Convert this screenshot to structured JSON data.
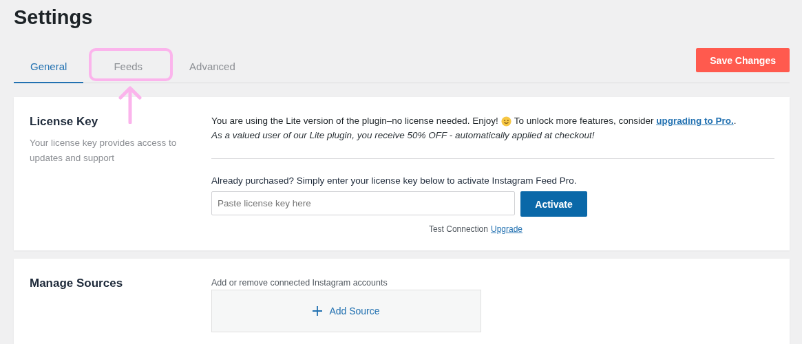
{
  "page": {
    "title": "Settings"
  },
  "tabs": [
    {
      "label": "General",
      "selected": true
    },
    {
      "label": "Feeds",
      "selected": false
    },
    {
      "label": "Advanced",
      "selected": false
    }
  ],
  "save_button": "Save Changes",
  "license": {
    "title": "License Key",
    "description": "Your license key provides access to updates and support",
    "intro_before": "You are using the Lite version of the plugin–no license needed. Enjoy!",
    "intro_after": "To unlock more features, consider",
    "intro_link": "upgrading to Pro.",
    "intro_end": ".",
    "discount": "As a valued user of our Lite plugin, you receive 50% OFF - automatically applied at checkout!",
    "prompt": "Already purchased? Simply enter your license key below to activate Instagram Feed Pro.",
    "field": {
      "placeholder": "Paste license key here"
    },
    "activate_button": "Activate",
    "test_connection": "Test Connection",
    "upgrade_link": "Upgrade"
  },
  "sources": {
    "title": "Manage Sources",
    "description": "Add or remove connected Instagram accounts",
    "add_button": "Add Source"
  }
}
